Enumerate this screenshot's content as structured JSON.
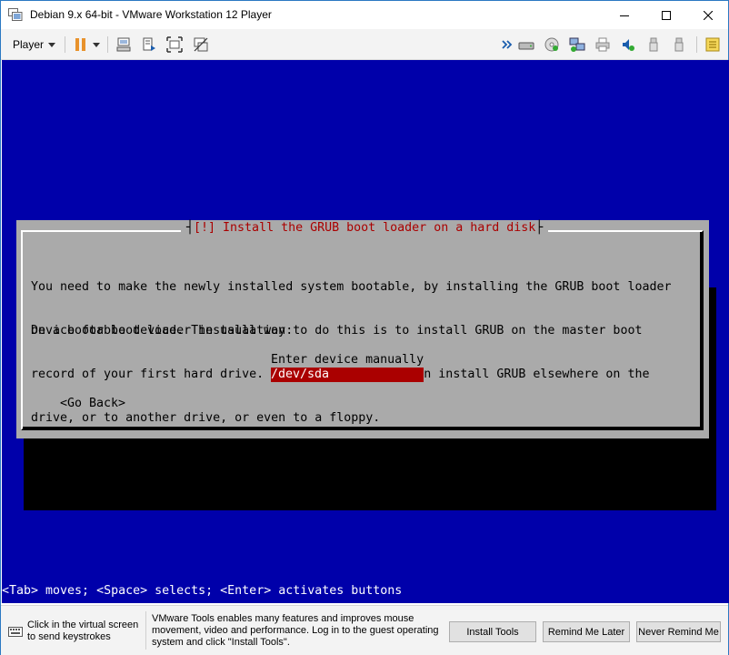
{
  "window": {
    "title": "Debian 9.x 64-bit - VMware Workstation 12 Player"
  },
  "toolbar": {
    "player_menu_label": "Player",
    "icons_left": [
      "pause-icon",
      "send-ctrl-alt-del-icon",
      "removable-devices-icon",
      "full-screen-icon",
      "unity-icon"
    ],
    "icons_right": [
      "more-icon",
      "hard-disk-icon",
      "cd-dvd-icon",
      "network-adapter-icon",
      "printer-icon",
      "sound-card-icon",
      "usb-icon",
      "message-log-icon"
    ]
  },
  "installer": {
    "dialog_title": "[!] Install the GRUB boot loader on a hard disk",
    "description_lines": [
      "You need to make the newly installed system bootable, by installing the GRUB boot loader",
      "on a bootable device. The usual way to do this is to install GRUB on the master boot",
      "record of your first hard drive. If you prefer, you can install GRUB elsewhere on the",
      "drive, or to another drive, or even to a floppy."
    ],
    "prompt": "Device for boot loader installation:",
    "options": [
      "Enter device manually",
      "/dev/sda"
    ],
    "selected_option": "/dev/sda",
    "go_back_label": "<Go Back>",
    "status_line": "<Tab> moves; <Space> selects; <Enter> activates buttons"
  },
  "notification": {
    "keyboard_hint": "Click in the virtual screen to send keystrokes",
    "tools_message": "VMware Tools enables many features and improves mouse movement, video and performance. Log in to the guest operating system and click \"Install Tools\".",
    "install_label": "Install Tools",
    "remind_later_label": "Remind Me Later",
    "never_remind_label": "Never Remind Me"
  },
  "colors": {
    "vm_background": "#0000aa",
    "dialog_background": "#aaaaaa",
    "title_red": "#aa0000",
    "selection_red": "#aa0000",
    "pause_orange": "#e8922c",
    "toolbar_blue": "#1a5dad"
  }
}
